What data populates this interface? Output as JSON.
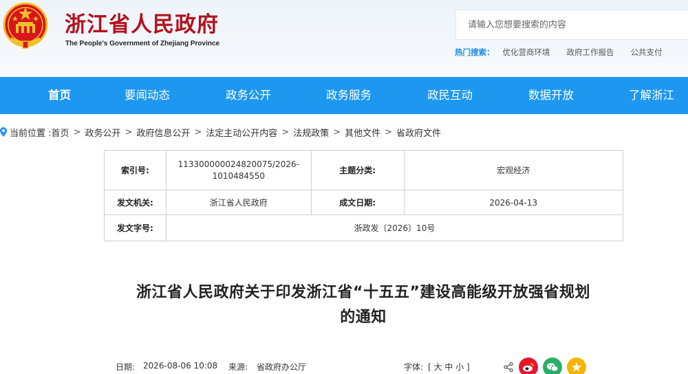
{
  "header": {
    "title": "浙江省人民政府",
    "subtitle": "The People's Government of Zhejiang Province",
    "search_placeholder": "请输入您想要搜索的内容",
    "hot_label": "热门搜索：",
    "hot_items": [
      "优化营商环境",
      "政府工作报告",
      "公共支付"
    ]
  },
  "nav": {
    "items": [
      "首页",
      "要闻动态",
      "政务公开",
      "政务服务",
      "政民互动",
      "数据开放",
      "了解浙江"
    ],
    "active": "首页"
  },
  "breadcrumb": {
    "prefix": "当前位置 :",
    "items": [
      "首页",
      "政务公开",
      "政府信息公开",
      "法定主动公开内容",
      "法规政策",
      "其他文件",
      "省政府文件"
    ],
    "separator": ">"
  },
  "meta": {
    "index_label": "索引号:",
    "index_value": "113300000024820075/2026-1010484550",
    "topic_label": "主题分类:",
    "topic_value": "宏观经济",
    "issuer_label": "发文机关:",
    "issuer_value": "浙江省人民政府",
    "date_label": "成文日期:",
    "date_value": "2026-04-13",
    "docno_label": "发文字号:",
    "docno_value": "浙政发〔2026〕10号"
  },
  "article": {
    "title_line1": "浙江省人民政府关于印发浙江省“十五五”建设高能级开放强省规划",
    "title_line2": "的通知",
    "date_label": "日期:",
    "date_value": "2026-08-06 10:08",
    "source_label": "来源:",
    "source_value": "省政府办公厅",
    "font_label": "字体:",
    "font_control": "[ 大 中 小 ]"
  },
  "colors": {
    "brand_red": "#b3121c",
    "nav_blue": "#1e97f0",
    "hot_blue": "#1d8ce0",
    "weibo": "#e6162d",
    "wechat": "#2aae67",
    "favorite": "#f5b400"
  }
}
